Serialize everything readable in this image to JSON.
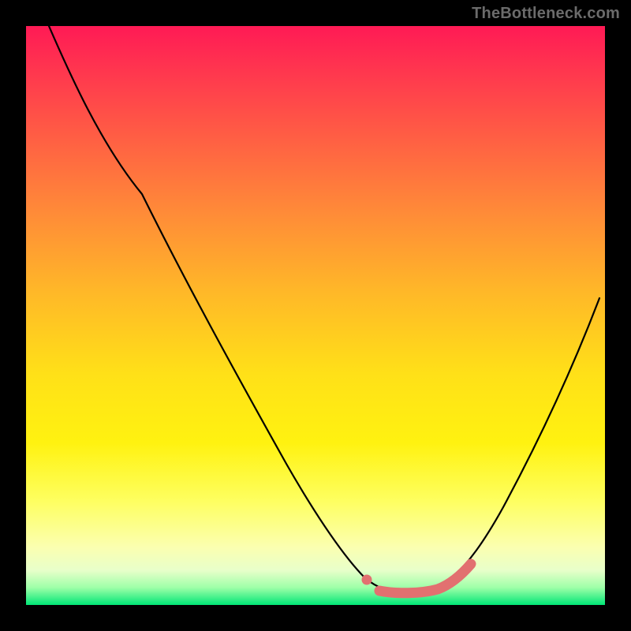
{
  "watermark": "TheBottleneck.com",
  "colors": {
    "background": "#000000",
    "curve": "#000000",
    "highlight": "#e27070",
    "gradient_top": "#ff1a55",
    "gradient_bottom": "#00e676"
  },
  "chart_data": {
    "type": "line",
    "title": "",
    "xlabel": "",
    "ylabel": "",
    "xlim": [
      0,
      100
    ],
    "ylim": [
      0,
      100
    ],
    "note": "Axes are unlabeled in the source image; x/y scaled 0–100 to the plot box. Values estimated from pixel positions.",
    "series": [
      {
        "name": "main-curve",
        "x": [
          4,
          10,
          20,
          30,
          40,
          50,
          56,
          60,
          63,
          67,
          72,
          76,
          80,
          86,
          92,
          99
        ],
        "y": [
          100,
          89,
          71,
          54,
          37,
          20,
          10,
          5,
          3,
          2.5,
          3,
          5,
          10,
          21,
          35,
          53
        ]
      },
      {
        "name": "highlight-segment",
        "x": [
          60,
          63,
          67,
          72,
          74.5,
          76.5
        ],
        "y": [
          5,
          3,
          2.5,
          3,
          4,
          6
        ]
      }
    ]
  }
}
